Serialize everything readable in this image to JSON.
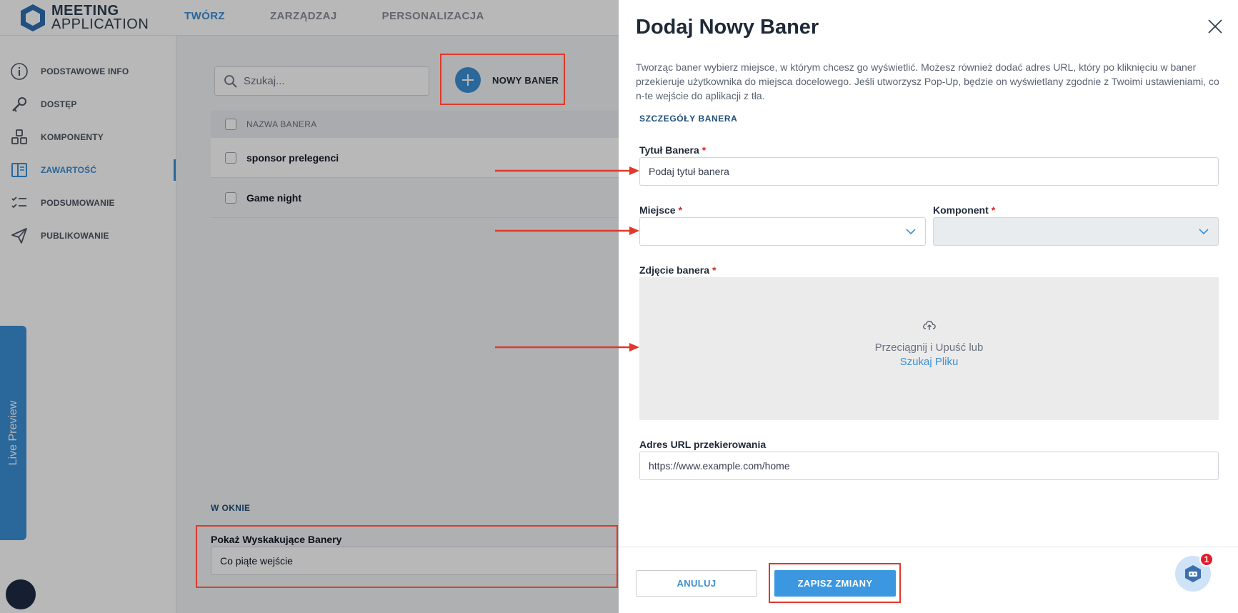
{
  "app": {
    "logo_line1": "MEETING",
    "logo_line2": "APPLICATION"
  },
  "topnav": {
    "items": [
      "TWÓRZ",
      "ZARZĄDZAJ",
      "PERSONALIZACJA"
    ],
    "active": "TWÓRZ"
  },
  "sidebar": {
    "items": [
      {
        "label": "PODSTAWOWE INFO",
        "icon": "info-icon"
      },
      {
        "label": "DOSTĘP",
        "icon": "key-icon"
      },
      {
        "label": "KOMPONENTY",
        "icon": "cubes-icon"
      },
      {
        "label": "ZAWARTOŚĆ",
        "icon": "layout-icon",
        "active": true
      },
      {
        "label": "PODSUMOWANIE",
        "icon": "checklist-icon"
      },
      {
        "label": "PUBLIKOWANIE",
        "icon": "send-icon"
      }
    ]
  },
  "live_preview": {
    "label": "Live Preview"
  },
  "content": {
    "search_placeholder": "Szukaj...",
    "new_banner_label": "NOWY BANER",
    "table": {
      "header": "NAZWA BANERA",
      "rows": [
        "sponsor prelegenci",
        "Game night"
      ]
    },
    "window_section_label": "W OKNIE",
    "popup_label": "Pokaż Wyskakujące Banery",
    "popup_value": "Co piąte wejście"
  },
  "drawer": {
    "title": "Dodaj Nowy Baner",
    "description": "Tworząc baner wybierz miejsce, w którym chcesz go wyświetlić. Możesz również dodać adres URL, który po kliknięciu w baner przekieruje użytkownika do miejsca docelowego. Jeśli utworzysz Pop-Up, będzie on wyświetlany zgodnie z Twoimi ustawieniami, co n-te wejście do aplikacji z tła.",
    "section_link": "SZCZEGÓŁY BANERA",
    "fields": {
      "title_label": "Tytuł Banera",
      "title_placeholder": "Podaj tytuł banera",
      "place_label": "Miejsce",
      "place_value": "",
      "component_label": "Komponent",
      "component_value": "",
      "image_label": "Zdjęcie banera",
      "dropzone_text": "Przeciągnij i Upuść lub",
      "dropzone_link": "Szukaj Pliku",
      "url_label": "Adres URL przekierowania",
      "url_value": "https://www.example.com/home"
    },
    "required_mark": "*",
    "cancel_label": "ANULUJ",
    "save_label": "ZAPISZ ZMIANY"
  },
  "chat": {
    "badge_count": "1"
  },
  "colors": {
    "accent": "#3b8fd6",
    "annotation_red": "#e0392b",
    "required": "#dc2626"
  }
}
